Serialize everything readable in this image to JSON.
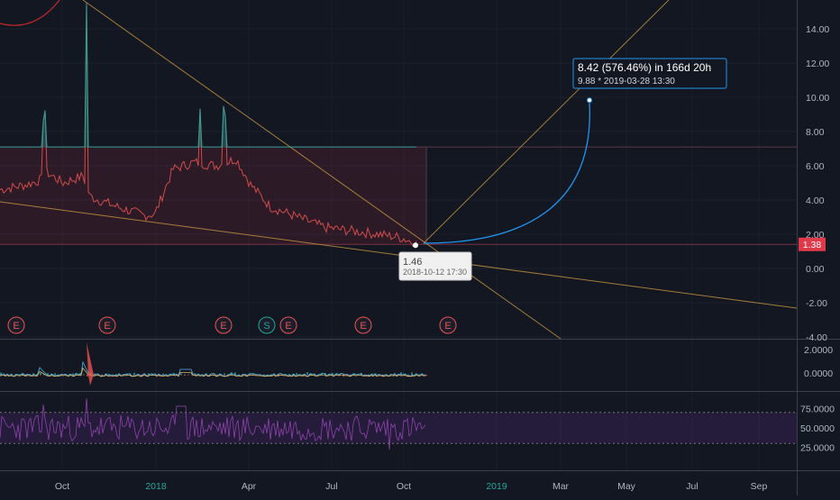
{
  "chart_data": {
    "type": "line",
    "y_axis": {
      "ticks": [
        "14.00",
        "12.00",
        "10.00",
        "8.00",
        "6.00",
        "4.00",
        "2.00",
        "0.00",
        "-2.00",
        "-4.00"
      ],
      "tick_values": [
        14,
        12,
        10,
        8,
        6,
        4,
        2,
        0,
        -2,
        -4
      ]
    },
    "x_axis": {
      "labels": [
        "Oct",
        "2018",
        "Apr",
        "Jul",
        "Oct",
        "2019",
        "Mar",
        "May",
        "Jul",
        "Sep"
      ],
      "year_labels": [
        "2018",
        "2019"
      ]
    },
    "price_series": {
      "name": "",
      "approx_points": [
        [
          "2017-09",
          4.6
        ],
        [
          "2017-10",
          5.2
        ],
        [
          "2017-10 peak",
          15.5
        ],
        [
          "2017-11",
          3.6
        ],
        [
          "2017-12",
          3.1
        ],
        [
          "2018-01",
          5.8
        ],
        [
          "2018-02 peak",
          9.2
        ],
        [
          "2018-03",
          6.5
        ],
        [
          "2018-04",
          3.8
        ],
        [
          "2018-05",
          3.0
        ],
        [
          "2018-06",
          2.4
        ],
        [
          "2018-07",
          2.2
        ],
        [
          "2018-08",
          2.0
        ],
        [
          "2018-09",
          1.7
        ],
        [
          "2018-10-12",
          1.46
        ]
      ]
    },
    "last_price_badge": "1.38",
    "horizontal_levels": [
      7.1,
      1.46
    ],
    "projection": {
      "label": "8.42 (576.46%) in 166d 20h",
      "sub": "9.88 *  2019-03-28  13:30",
      "target_value": 9.88,
      "target_date": "2019-03-28"
    },
    "anchor_point": {
      "value": "1.46",
      "date": "2018-10-12 17:30"
    },
    "event_markers": [
      "E",
      "E",
      "E",
      "S",
      "E",
      "E",
      "E"
    ],
    "macd_panel": {
      "ticks": [
        "2.0000",
        "0.0000"
      ]
    },
    "rsi_panel": {
      "ticks": [
        "75.0000",
        "50.0000",
        "25.0000"
      ],
      "upper_band": 70,
      "lower_band": 30
    },
    "colors": {
      "background": "#131722",
      "up": "#26a69a",
      "down": "#ef5350",
      "trendline": "#c8963e",
      "projection": "#2196f3",
      "rsi": "#9c27b0",
      "badge": "#e0394a"
    }
  }
}
